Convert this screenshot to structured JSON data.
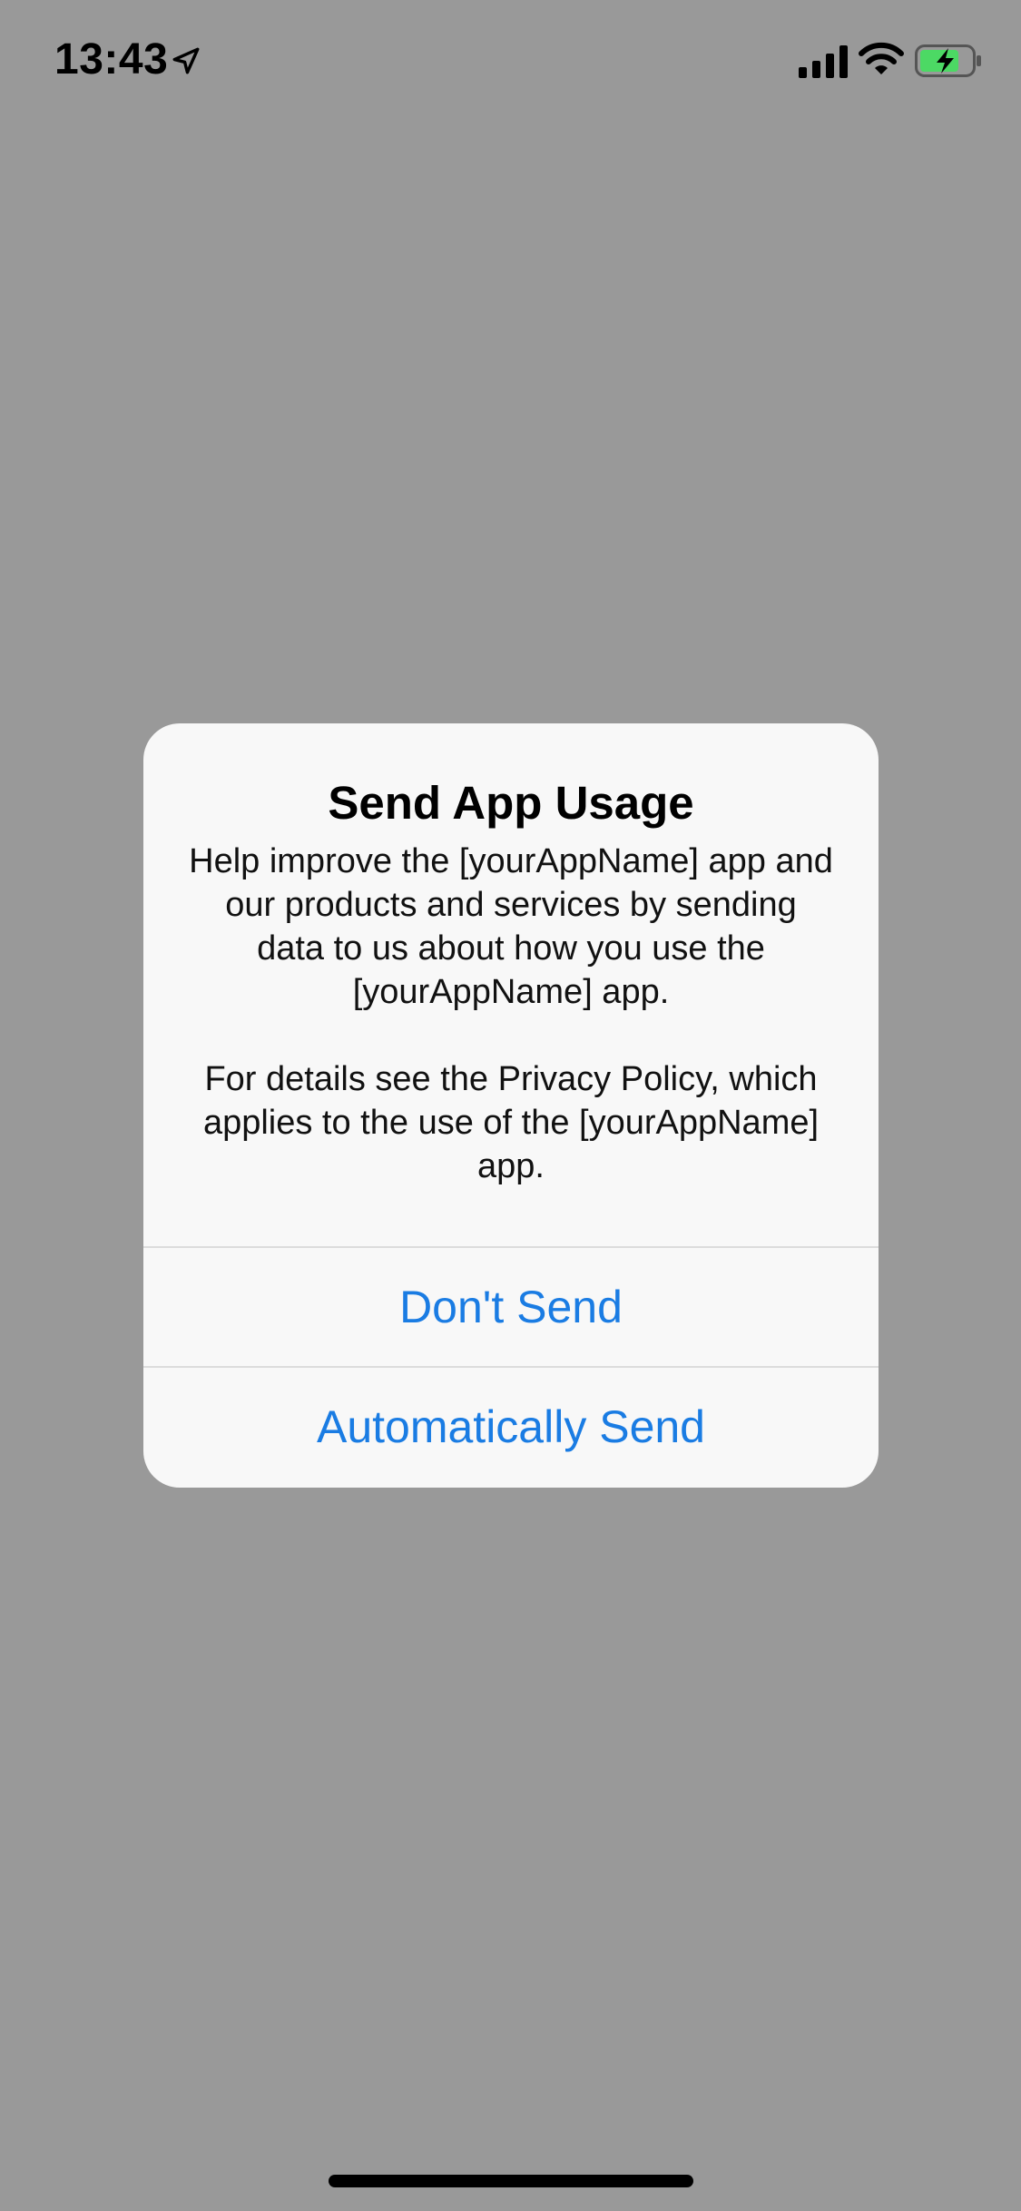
{
  "status_bar": {
    "time": "13:43",
    "icons": {
      "location": "location-arrow-icon",
      "signal": "cellular-signal-icon",
      "wifi": "wifi-icon",
      "battery": "battery-charging-icon"
    },
    "battery_color": "#4cd964"
  },
  "alert": {
    "title": "Send App Usage",
    "message_paragraph_1": "Help improve the [yourAppName] app and our products and services by sending data to us about how you use the [yourAppName] app.",
    "message_paragraph_2": "For details see the Privacy Policy, which applies to the use of the [yourAppName] app.",
    "buttons": [
      {
        "label": "Don't Send"
      },
      {
        "label": "Automatically Send"
      }
    ]
  },
  "colors": {
    "backdrop": "#999999",
    "alert_background": "#f8f8f8",
    "button_text": "#1a7ce3"
  }
}
